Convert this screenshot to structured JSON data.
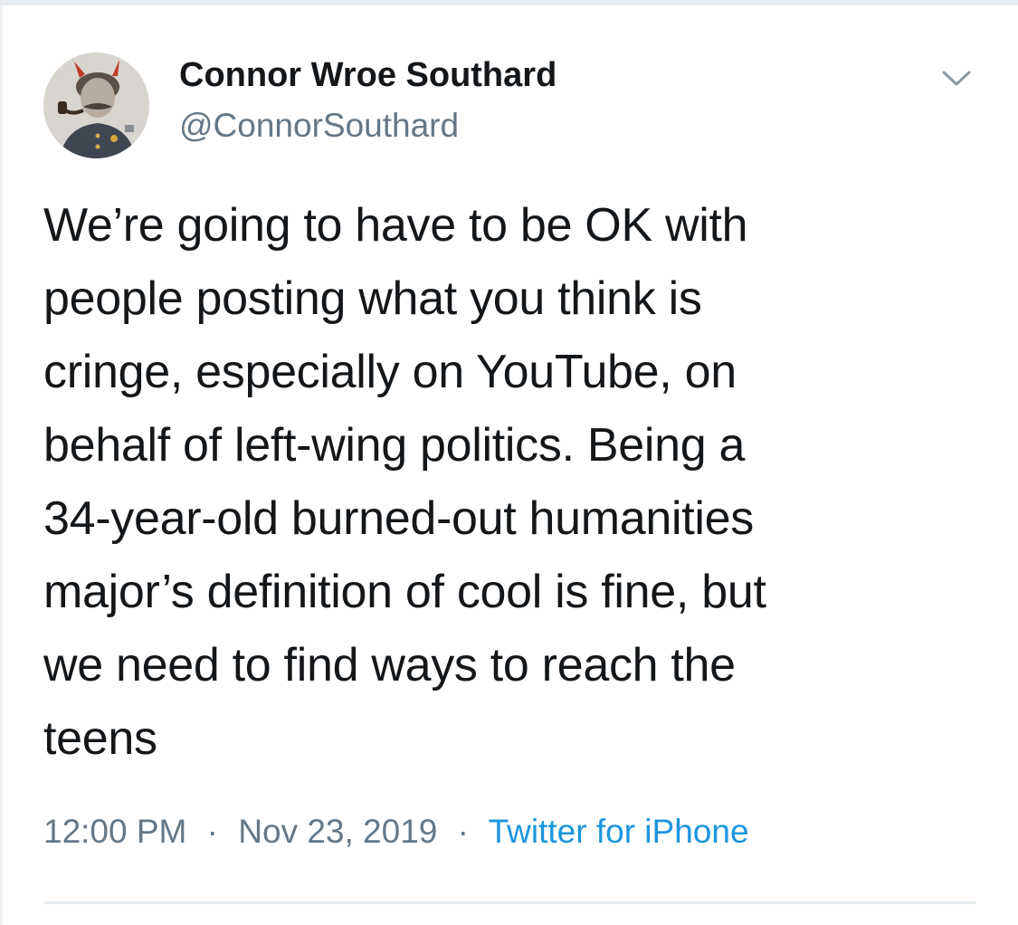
{
  "tweet": {
    "author_name": "Connor Wroe Southard",
    "author_handle": "@ConnorSouthard",
    "text_lines": [
      "We’re going to have to be OK with",
      "people posting what you think is",
      "cringe, especially on YouTube, on",
      "behalf of left-wing politics. Being a",
      "34-year-old burned-out humanities",
      "major’s definition of cool is fine, but",
      "we need to find ways to reach the",
      "teens"
    ],
    "time": "12:00 PM",
    "separator": "·",
    "date": "Nov 23, 2019",
    "source": "Twitter for iPhone"
  },
  "icons": {
    "avatar": "avatar-portrait-icon",
    "menu": "chevron-down-icon"
  },
  "colors": {
    "text": "#14171a",
    "muted": "#657786",
    "link": "#1b95e0",
    "divider": "#e6ecf0"
  }
}
